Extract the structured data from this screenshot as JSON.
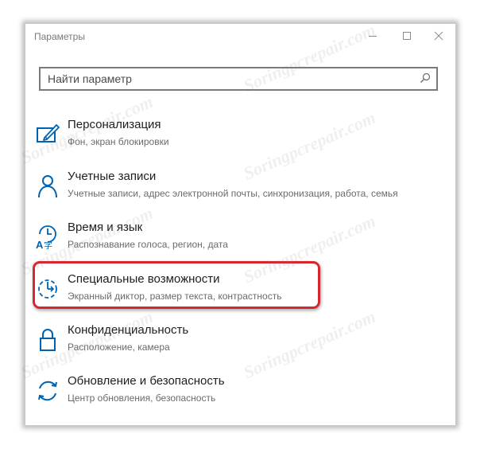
{
  "window": {
    "title": "Параметры",
    "controls": [
      "minimize",
      "maximize",
      "close"
    ]
  },
  "search": {
    "placeholder": "Найти параметр",
    "value": "",
    "icon": "search-icon"
  },
  "items": [
    {
      "label": "Персонализация",
      "desc": "Фон, экран блокировки",
      "icon": "personalization-icon"
    },
    {
      "label": "Учетные записи",
      "desc": "Учетные записи, адрес электронной почты, синхронизация, работа, семья",
      "icon": "accounts-icon"
    },
    {
      "label": "Время и язык",
      "desc": "Распознавание голоса, регион, дата",
      "icon": "time-language-icon"
    },
    {
      "label": "Специальные возможности",
      "desc": "Экранный диктор, размер текста, контрастность",
      "icon": "ease-of-access-icon",
      "highlighted": true
    },
    {
      "label": "Конфиденциальность",
      "desc": "Расположение, камера",
      "icon": "privacy-lock-icon"
    },
    {
      "label": "Обновление и безопасность",
      "desc": "Центр обновления, безопасность",
      "icon": "update-icon"
    }
  ],
  "watermark": "Soringpcrepair.com",
  "colors": {
    "accent": "#0063b1",
    "highlight_border": "#d8262f",
    "title_text": "#7a7a7a",
    "desc_text": "#6b6b6b"
  }
}
